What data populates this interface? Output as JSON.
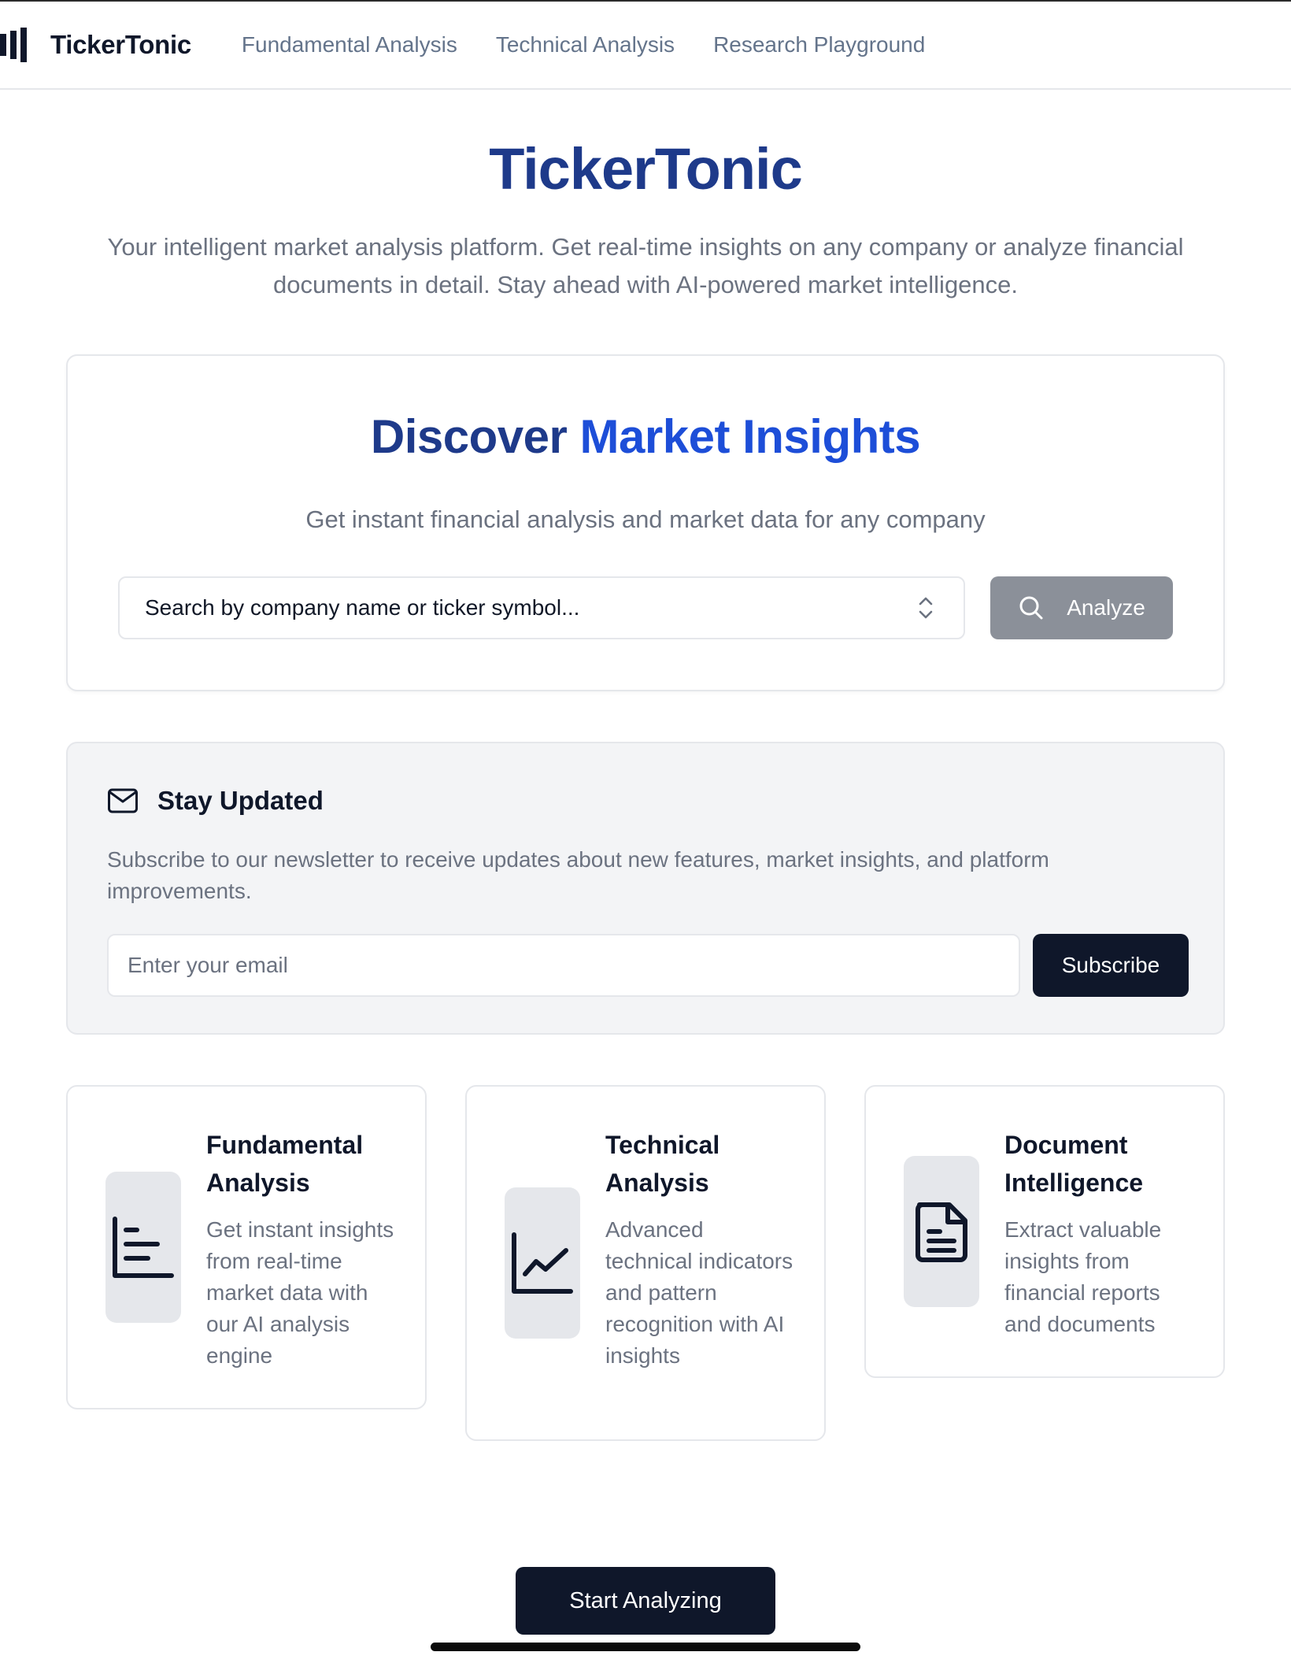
{
  "header": {
    "brand": "TickerTonic",
    "logo_icon": "bars-logo-icon",
    "nav": [
      {
        "label": "Fundamental Analysis"
      },
      {
        "label": "Technical Analysis"
      },
      {
        "label": "Research Playground"
      }
    ]
  },
  "hero": {
    "title": "TickerTonic",
    "subtitle": "Your intelligent market analysis platform. Get real-time insights on any company or analyze financial documents in detail. Stay ahead with AI-powered market intelligence."
  },
  "search": {
    "title_part1": "Discover ",
    "title_part2": "Market Insights",
    "subtitle": "Get instant financial analysis and market data for any company",
    "input_text": "Search by company name or ticker symbol...",
    "analyze_label": "Analyze"
  },
  "newsletter": {
    "title": "Stay Updated",
    "description": "Subscribe to our newsletter to receive updates about new features, market insights, and platform improvements.",
    "email_placeholder": "Enter your email",
    "subscribe_label": "Subscribe"
  },
  "features": [
    {
      "title": "Fundamental Analysis",
      "description": "Get instant insights from real-time market data with our AI analysis engine",
      "icon": "bar-chart-icon"
    },
    {
      "title": "Technical Analysis",
      "description": "Advanced technical indicators and pattern recognition with AI insights",
      "icon": "line-chart-icon"
    },
    {
      "title": "Document Intelligence",
      "description": "Extract valuable insights from financial reports and documents",
      "icon": "file-text-icon"
    }
  ],
  "cta": {
    "start_label": "Start Analyzing"
  },
  "colors": {
    "primary_dark": "#0f172a",
    "brand_navy": "#1e3a8a",
    "brand_blue": "#1d4ed8",
    "muted_text": "#6b7280",
    "border": "#e5e7eb",
    "disabled_button": "#8b9099"
  }
}
